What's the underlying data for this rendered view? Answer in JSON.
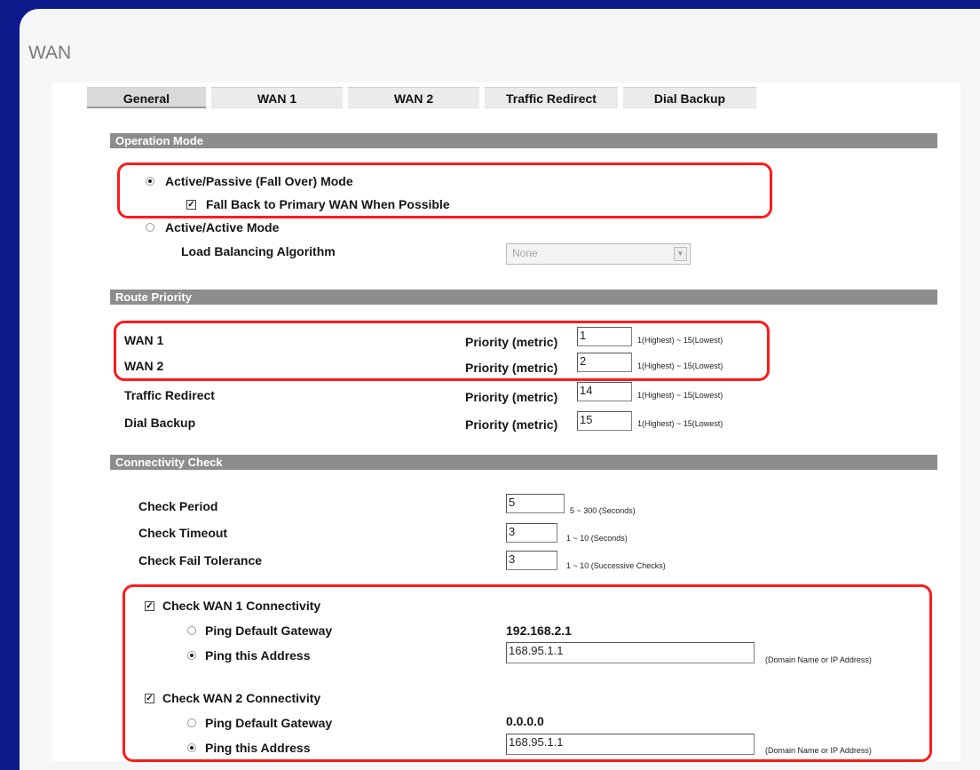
{
  "page_title": "WAN",
  "tabs": [
    {
      "label": "General"
    },
    {
      "label": "WAN 1"
    },
    {
      "label": "WAN 2"
    },
    {
      "label": "Traffic Redirect"
    },
    {
      "label": "Dial Backup"
    }
  ],
  "operation_mode": {
    "header": "Operation Mode",
    "active_passive_label": "Active/Passive (Fall Over) Mode",
    "fallback_label": "Fall Back to Primary WAN When Possible",
    "active_active_label": "Active/Active Mode",
    "load_balancing_label": "Load Balancing Algorithm",
    "load_balancing_value": "None"
  },
  "route_priority": {
    "header": "Route Priority",
    "priority_label": "Priority (metric)",
    "range_hint": "1(Highest) ~ 15(Lowest)",
    "rows": [
      {
        "name": "WAN 1",
        "value": "1"
      },
      {
        "name": "WAN 2",
        "value": "2"
      },
      {
        "name": "Traffic Redirect",
        "value": "14"
      },
      {
        "name": "Dial Backup",
        "value": "15"
      }
    ]
  },
  "connectivity": {
    "header": "Connectivity Check",
    "check_period_label": "Check Period",
    "check_period_value": "5",
    "check_period_hint": "5 ~ 300 (Seconds)",
    "check_timeout_label": "Check Timeout",
    "check_timeout_value": "3",
    "check_timeout_hint": "1 ~ 10 (Seconds)",
    "check_fail_label": "Check Fail Tolerance",
    "check_fail_value": "3",
    "check_fail_hint": "1 ~ 10 (Successive Checks)",
    "ping_gateway_label": "Ping Default Gateway",
    "ping_address_label": "Ping this Address",
    "address_hint": "(Domain Name or IP Address)",
    "wan1": {
      "check_label": "Check WAN 1 Connectivity",
      "gateway_ip": "192.168.2.1",
      "ping_address": "168.95.1.1"
    },
    "wan2": {
      "check_label": "Check WAN 2 Connectivity",
      "gateway_ip": "0.0.0.0",
      "ping_address": "168.95.1.1"
    }
  },
  "colors": {
    "highlight": "#ff1a1a",
    "section_header": "#8d8d8d",
    "frame": "#0d1a8c"
  }
}
